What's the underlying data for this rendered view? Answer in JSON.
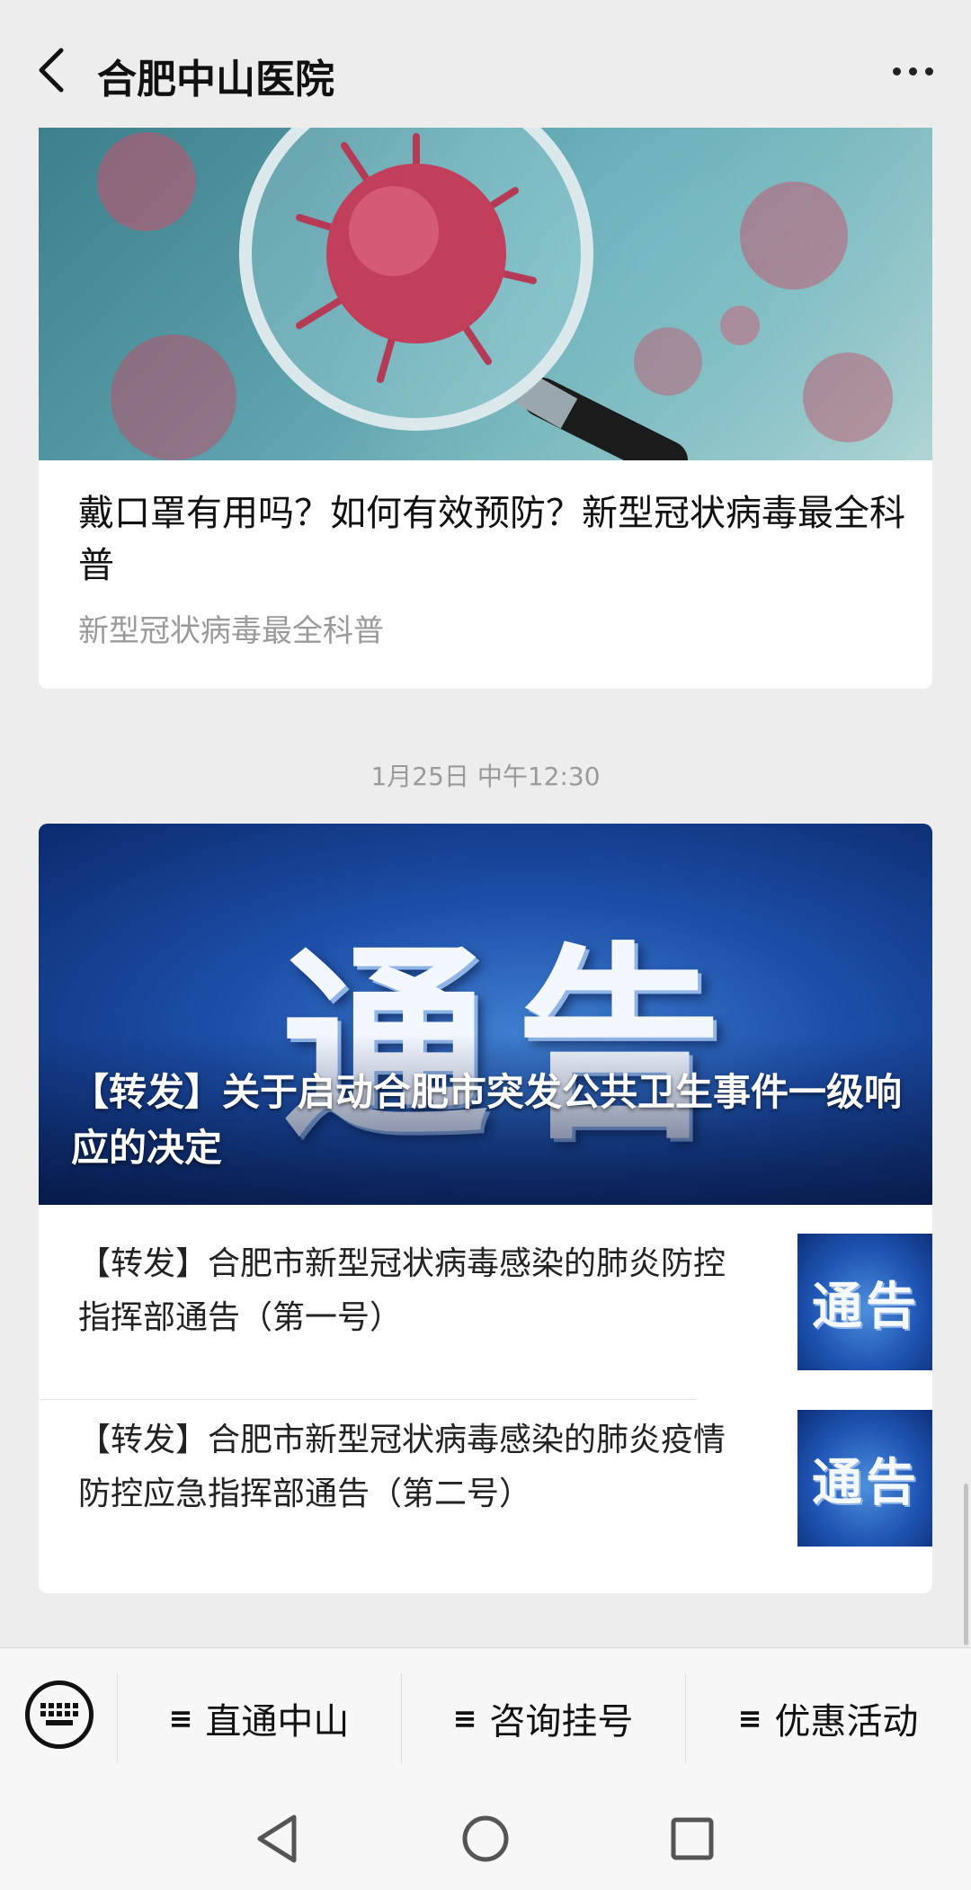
{
  "header": {
    "title": "合肥中山医院"
  },
  "article1": {
    "title": "戴口罩有用吗？如何有效预防？新型冠状病毒最全科普",
    "subtitle": "新型冠状病毒最全科普"
  },
  "timestamp": "1月25日 中午12:30",
  "article2": {
    "banner_chars": "通告",
    "main_title": "【转发】关于启动合肥市突发公共卫生事件一级响应的决定",
    "items": [
      {
        "title": "【转发】合肥市新型冠状病毒感染的肺炎防控指挥部通告（第一号）",
        "thumb_text": "通告"
      },
      {
        "title": "【转发】合肥市新型冠状病毒感染的肺炎疫情防控应急指挥部通告（第二号）",
        "thumb_text": "通告"
      }
    ]
  },
  "menu": {
    "hamburger": "≡",
    "items": [
      {
        "label": "直通中山"
      },
      {
        "label": "咨询挂号"
      },
      {
        "label": "优惠活动"
      }
    ]
  },
  "colors": {
    "page_bg": "#ededed",
    "card_bg": "#ffffff",
    "notice_blue": "#1d4ea8"
  },
  "icons": {
    "back": "back-arrow-icon",
    "more": "more-dots-icon",
    "keyboard": "keyboard-icon",
    "nav_back": "triangle-back-icon",
    "nav_home": "circle-home-icon",
    "nav_recent": "square-recent-icon"
  }
}
